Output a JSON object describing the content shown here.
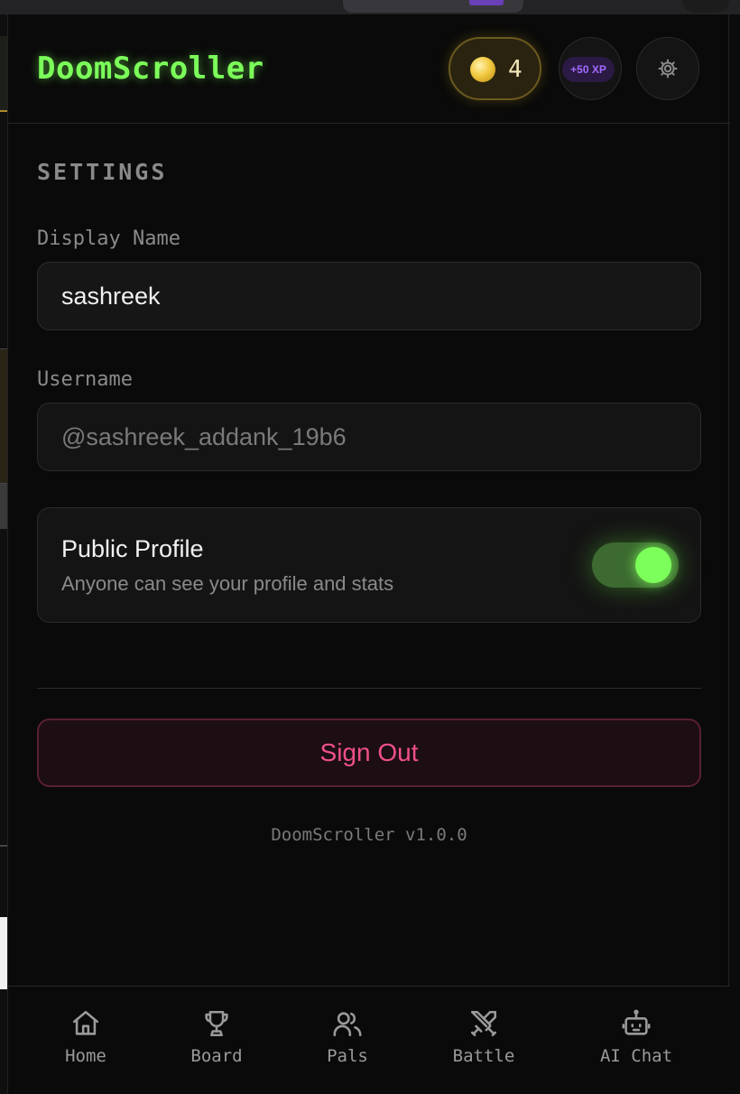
{
  "app": {
    "title": "DoomScroller"
  },
  "header": {
    "coin_count": "4",
    "xp_badge": "+50 XP",
    "icons": {
      "coin": "coin-icon",
      "settings": "gear-icon"
    }
  },
  "settings": {
    "section_title": "SETTINGS",
    "display_name": {
      "label": "Display Name",
      "value": "sashreek"
    },
    "username": {
      "label": "Username",
      "value": "@sashreek_addank_19b6"
    },
    "public_profile": {
      "title": "Public Profile",
      "subtitle": "Anyone can see your profile and stats",
      "enabled": true
    },
    "sign_out_label": "Sign Out",
    "version": "DoomScroller v1.0.0"
  },
  "nav": {
    "items": [
      {
        "label": "Home",
        "icon": "home-icon"
      },
      {
        "label": "Board",
        "icon": "trophy-icon"
      },
      {
        "label": "Pals",
        "icon": "users-icon"
      },
      {
        "label": "Battle",
        "icon": "swords-icon"
      },
      {
        "label": "AI Chat",
        "icon": "bot-icon"
      }
    ]
  },
  "colors": {
    "accent_green": "#7cff5a",
    "sign_out_pink": "#f0508a",
    "xp_purple": "#a26bff",
    "coin_gold": "#f2c940",
    "background": "#0a0a0a"
  }
}
